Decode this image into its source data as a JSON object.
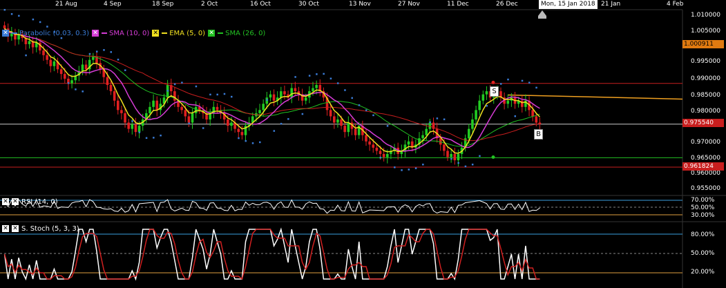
{
  "x_axis": {
    "labels": [
      "21 Aug",
      "4 Sep",
      "18 Sep",
      "2 Oct",
      "16 Oct",
      "30 Oct",
      "13 Nov",
      "27 Nov",
      "11 Dec",
      "26 Dec",
      "21 Jan",
      "4 Feb"
    ],
    "crosshair_date": "Mon, 15 Jan 2018"
  },
  "price_panel": {
    "indicators": [
      {
        "name": "Parabolic (0.03, 0.3)",
        "color": "#3a7bd5"
      },
      {
        "name": "SMA (10, 0)",
        "color": "#d63cd6"
      },
      {
        "name": "EMA (5, 0)",
        "color": "#f0e020"
      },
      {
        "name": "SMA (26, 0)",
        "color": "#22c022"
      }
    ],
    "y_labels": [
      "1.010000",
      "1.005000",
      "0.995000",
      "0.990000",
      "0.985000",
      "0.980000",
      "0.970000",
      "0.965000",
      "0.960000",
      "0.955000"
    ],
    "tags": [
      {
        "text": "1.000911",
        "color": "#e07a10"
      },
      {
        "text": "0.975540",
        "color": "#c81e1e"
      },
      {
        "text": "0.961824",
        "color": "#c81e1e"
      }
    ],
    "signals": {
      "sell": "S",
      "buy": "B"
    }
  },
  "rsi_panel": {
    "title": "RSI (14, 0)",
    "y_labels": [
      "70.00%",
      "50.00%",
      "30.00%"
    ]
  },
  "stoch_panel": {
    "title": "S. Stoch (5, 3, 3)",
    "y_labels": [
      "80.00%",
      "50.00%",
      "20.00%"
    ]
  },
  "colors": {
    "up": "#22cc22",
    "down": "#e02020",
    "rsi_band": "#3aa0e0",
    "stoch_fill_high": "#1e6a8a",
    "stoch_fill_low": "#8a5a10"
  },
  "chart_data": {
    "type": "candlestick",
    "ylim": [
      0.953,
      1.012
    ],
    "reference_lines": [
      0.9885,
      0.9755,
      0.9648,
      0.9618
    ],
    "trend_line": {
      "from_price": 0.9848,
      "to_price": 0.9835
    },
    "closes": [
      1.006,
      1.0035,
      1.0045,
      1.0025,
      1.004,
      1.003,
      1.001,
      1.002,
      1.0,
      1.0015,
      0.999,
      0.9975,
      0.996,
      0.994,
      0.9955,
      0.993,
      0.9915,
      0.99,
      0.9885,
      0.9895,
      0.991,
      0.9925,
      0.9945,
      0.993,
      0.996,
      0.997,
      0.995,
      0.993,
      0.9905,
      0.988,
      0.986,
      0.983,
      0.98,
      0.979,
      0.976,
      0.974,
      0.9755,
      0.973,
      0.975,
      0.977,
      0.979,
      0.981,
      0.983,
      0.98,
      0.982,
      0.984,
      0.988,
      0.986,
      0.983,
      0.981,
      0.98,
      0.978,
      0.976,
      0.979,
      0.981,
      0.98,
      0.979,
      0.977,
      0.979,
      0.981,
      0.98,
      0.979,
      0.977,
      0.975,
      0.976,
      0.974,
      0.973,
      0.972,
      0.975,
      0.976,
      0.978,
      0.979,
      0.98,
      0.982,
      0.984,
      0.985,
      0.983,
      0.984,
      0.986,
      0.985,
      0.984,
      0.987,
      0.986,
      0.985,
      0.983,
      0.984,
      0.986,
      0.987,
      0.988,
      0.986,
      0.984,
      0.98,
      0.978,
      0.976,
      0.977,
      0.975,
      0.973,
      0.976,
      0.974,
      0.972,
      0.975,
      0.972,
      0.97,
      0.969,
      0.968,
      0.967,
      0.966,
      0.965,
      0.966,
      0.967,
      0.968,
      0.966,
      0.967,
      0.969,
      0.97,
      0.968,
      0.969,
      0.971,
      0.972,
      0.974,
      0.976,
      0.974,
      0.971,
      0.969,
      0.967,
      0.965,
      0.966,
      0.964,
      0.966,
      0.968,
      0.971,
      0.974,
      0.977,
      0.98,
      0.983,
      0.985,
      0.986,
      0.984,
      0.985,
      0.986,
      0.984,
      0.982,
      0.983,
      0.984,
      0.982,
      0.983,
      0.981,
      0.983,
      0.98,
      0.978,
      0.976,
      0.9755
    ]
  }
}
